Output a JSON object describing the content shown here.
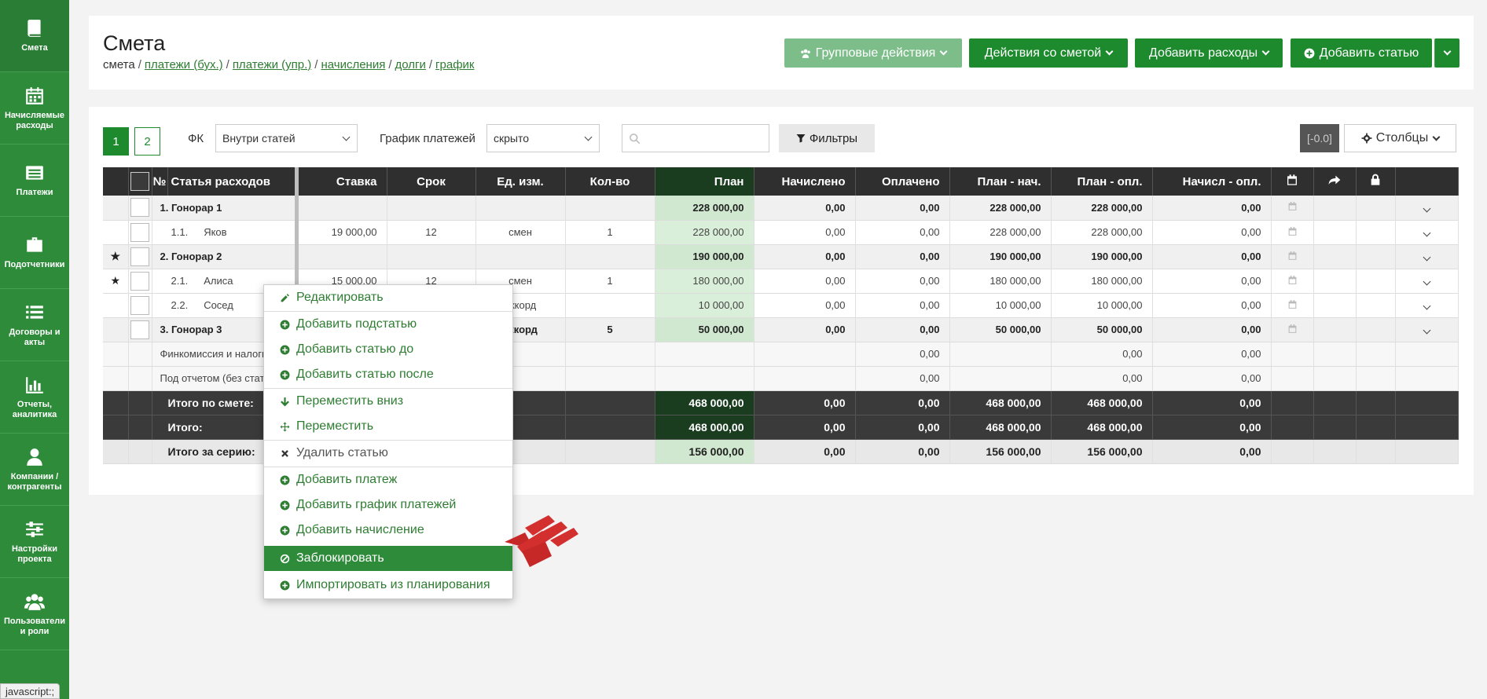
{
  "sidebar": {
    "items": [
      {
        "label": "Смета",
        "icon": "book-icon"
      },
      {
        "label": "Начисляемые расходы",
        "icon": "calendar-icon"
      },
      {
        "label": "Платежи",
        "icon": "list-icon"
      },
      {
        "label": "Подотчетники",
        "icon": "briefcase-icon"
      },
      {
        "label": "Договоры и акты",
        "icon": "list-bullets-icon"
      },
      {
        "label": "Отчеты, аналитика",
        "icon": "bar-chart-icon"
      },
      {
        "label": "Компании / контрагенты",
        "icon": "user-icon"
      },
      {
        "label": "Настройки проекта",
        "icon": "sliders-icon"
      },
      {
        "label": "Пользователи и роли",
        "icon": "users-icon"
      }
    ]
  },
  "status_tip": "javascript:;",
  "header": {
    "title": "Смета",
    "breadcrumb": {
      "current": "смета",
      "links": [
        "платежи (бух.)",
        "платежи (упр.)",
        "начисления",
        "долги",
        "график"
      ]
    },
    "buttons": {
      "group_actions": "Групповые действия",
      "estimate_actions": "Действия со сметой",
      "add_expenses": "Добавить расходы",
      "add_item": "Добавить статью"
    }
  },
  "toolbar": {
    "pages": [
      "1",
      "2"
    ],
    "fk_label": "ФК",
    "fk_value": "Внутри статей",
    "schedule_label": "График платежей",
    "schedule_value": "скрыто",
    "search_placeholder": "",
    "filters_label": "Фильтры",
    "zero_badge": "[-0.0]",
    "columns_label": "Столбцы"
  },
  "table": {
    "headers": {
      "num": "№",
      "item": "Статья расходов",
      "rate": "Ставка",
      "term": "Срок",
      "unit": "Ед. изм.",
      "qty": "Кол-во",
      "plan": "План",
      "accrued": "Начислено",
      "paid": "Оплачено",
      "plan_acc": "План - нач.",
      "plan_paid": "План - опл.",
      "acc_paid": "Начисл - опл."
    },
    "rows": [
      {
        "star": "",
        "label": "1. Гонорар 1",
        "rate": "",
        "term": "",
        "unit": "",
        "qty": "",
        "plan": "228 000,00",
        "accrued": "0,00",
        "paid": "0,00",
        "plan_acc": "228 000,00",
        "plan_paid": "228 000,00",
        "acc_paid": "0,00"
      },
      {
        "star": "",
        "num": "1.1.",
        "label": "Яков",
        "rate": "19 000,00",
        "term": "12",
        "unit": "смен",
        "qty": "1",
        "plan": "228 000,00",
        "accrued": "0,00",
        "paid": "0,00",
        "plan_acc": "228 000,00",
        "plan_paid": "228 000,00",
        "acc_paid": "0,00"
      },
      {
        "star": "★",
        "label": "2. Гонорар 2",
        "rate": "",
        "term": "",
        "unit": "",
        "qty": "",
        "plan": "190 000,00",
        "accrued": "0,00",
        "paid": "0,00",
        "plan_acc": "190 000,00",
        "plan_paid": "190 000,00",
        "acc_paid": "0,00"
      },
      {
        "star": "★",
        "num": "2.1.",
        "label": "Алиса",
        "rate": "15 000,00",
        "term": "12",
        "unit": "смен",
        "qty": "1",
        "plan": "180 000,00",
        "accrued": "0,00",
        "paid": "0,00",
        "plan_acc": "180 000,00",
        "plan_paid": "180 000,00",
        "acc_paid": "0,00"
      },
      {
        "star": "",
        "num": "2.2.",
        "label": "Сосед",
        "rate": "",
        "term": "",
        "unit": "аккорд",
        "qty": "",
        "plan": "10 000,00",
        "accrued": "0,00",
        "paid": "0,00",
        "plan_acc": "10 000,00",
        "plan_paid": "10 000,00",
        "acc_paid": "0,00"
      },
      {
        "star": "",
        "label": "3. Гонорар 3",
        "rate": "",
        "term": "",
        "unit": "аккорд",
        "qty": "5",
        "plan": "50 000,00",
        "accrued": "0,00",
        "paid": "0,00",
        "plan_acc": "50 000,00",
        "plan_paid": "50 000,00",
        "acc_paid": "0,00"
      }
    ],
    "fin_commission": {
      "label": "Финкомиссия и налоги",
      "paid": "0,00",
      "plan_paid": "0,00",
      "acc_paid": "0,00"
    },
    "under_report": {
      "label": "Под отчетом (без статьи)",
      "paid": "0,00",
      "plan_paid": "0,00",
      "acc_paid": "0,00"
    },
    "total_estimate": {
      "label": "Итого по смете:",
      "plan": "468 000,00",
      "accrued": "0,00",
      "paid": "0,00",
      "plan_acc": "468 000,00",
      "plan_paid": "468 000,00",
      "acc_paid": "0,00"
    },
    "total": {
      "label": "Итого:",
      "plan": "468 000,00",
      "accrued": "0,00",
      "paid": "0,00",
      "plan_acc": "468 000,00",
      "plan_paid": "468 000,00",
      "acc_paid": "0,00"
    },
    "total_series": {
      "label": "Итого за серию:",
      "plan": "156 000,00",
      "accrued": "0,00",
      "paid": "0,00",
      "plan_acc": "156 000,00",
      "plan_paid": "156 000,00",
      "acc_paid": "0,00"
    }
  },
  "context_menu": {
    "edit": "Редактировать",
    "add_sub": "Добавить подстатью",
    "add_before": "Добавить статью до",
    "add_after": "Добавить статью после",
    "move_down": "Переместить вниз",
    "move": "Переместить",
    "delete": "Удалить статью",
    "add_payment": "Добавить платеж",
    "add_schedule": "Добавить график платежей",
    "add_accrual": "Добавить начисление",
    "block": "Заблокировать",
    "import": "Импортировать из планирования"
  },
  "colors": {
    "brand": "#2e8b3a",
    "button_dark": "#1e8a2e",
    "button_light": "#7dbd8a",
    "plan_column": "#d9efd9",
    "table_header": "#2f2f2f",
    "pointer_arrow": "#d32f2f"
  }
}
